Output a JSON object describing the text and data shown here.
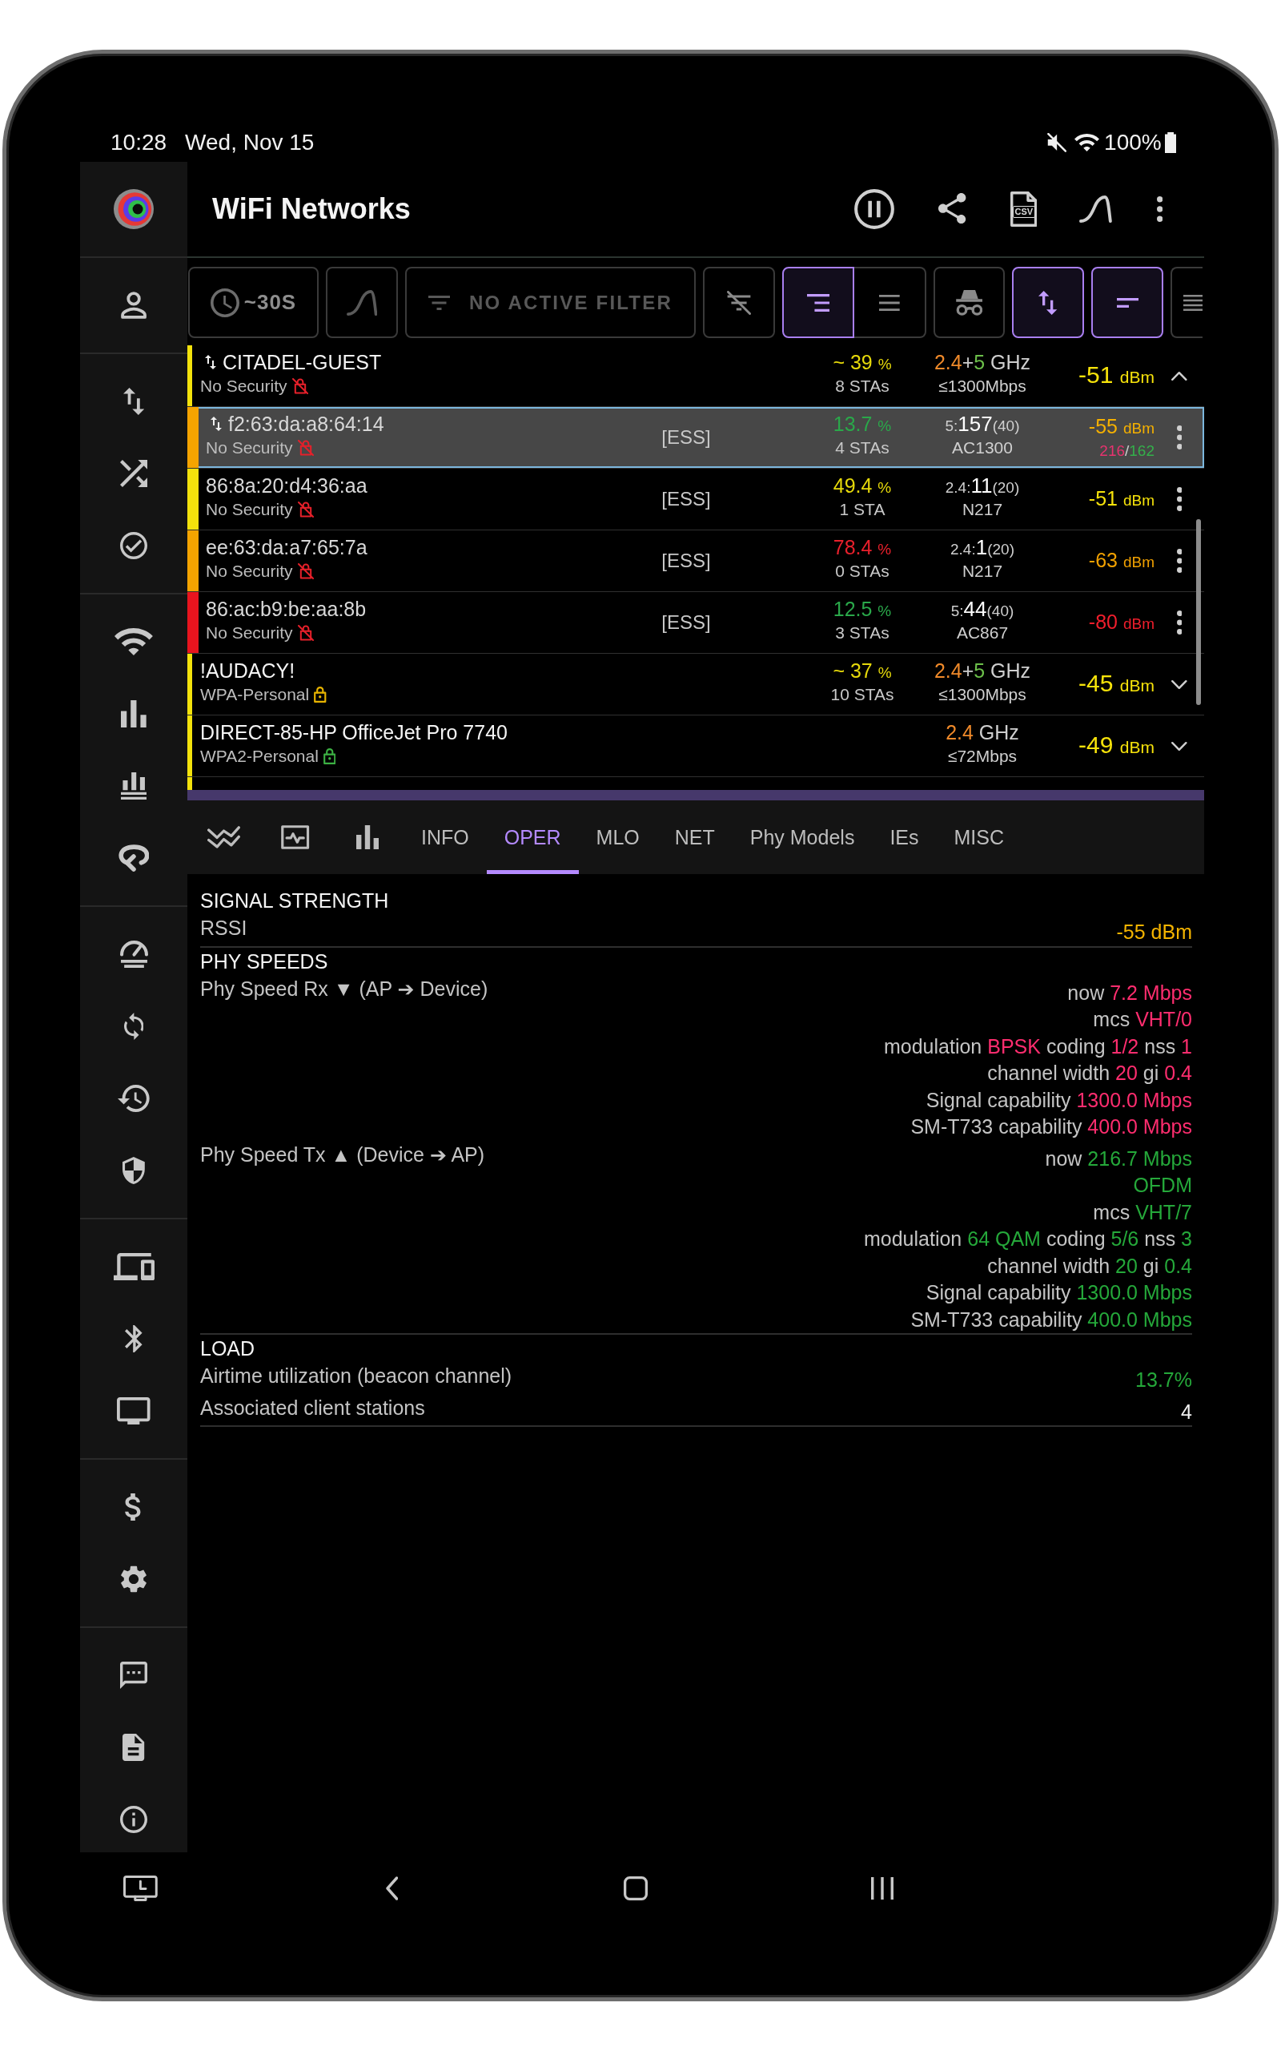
{
  "status_bar": {
    "time": "10:28",
    "date": "Wed, Nov 15",
    "battery": "100%"
  },
  "app_bar": {
    "title": "WiFi Networks",
    "export_label": "CSV"
  },
  "toolbar": [
    {
      "kind": "interval",
      "label": "~30S",
      "selected": false
    },
    {
      "kind": "graph",
      "selected": false
    },
    {
      "kind": "filter",
      "label": "NO ACTIVE FILTER",
      "selected": false
    },
    {
      "kind": "filter-off",
      "selected": false
    },
    {
      "kind": "group",
      "selected": true
    },
    {
      "kind": "ungroup",
      "selected": false
    },
    {
      "kind": "incognito",
      "selected": false
    },
    {
      "kind": "sort",
      "selected": true
    },
    {
      "kind": "compact",
      "selected": true
    },
    {
      "kind": "list",
      "selected": false
    }
  ],
  "networks": [
    {
      "kind": "network",
      "name": "CITADEL-GUEST",
      "connected": true,
      "selected": false,
      "expanded": true,
      "security": "No Security",
      "lock": {
        "kind": "unlocked",
        "color": "#e5202a"
      },
      "color": "#f3e20c",
      "load": {
        "prefix": "~",
        "value": "39",
        "unit": "%",
        "color": "#e6d90a"
      },
      "stations": "8 STAs",
      "band": {
        "low": "2.4",
        "sep": "+",
        "high": "5",
        "unit": "GHz"
      },
      "rate": "≤1300Mbps",
      "rssi": {
        "value": "-51",
        "unit": "dBm",
        "color": "#f7e30a"
      },
      "children": [
        {
          "kind": "bssid",
          "name": "f2:63:da:a8:64:14",
          "connected": true,
          "selected": true,
          "security": "No Security",
          "lock": {
            "kind": "unlocked",
            "color": "#e5202a"
          },
          "mode": "[ESS]",
          "color": "#f5a400",
          "load": {
            "value": "13.7",
            "unit": "%",
            "color": "#2aa84a"
          },
          "stations": "4 STAs",
          "channel": {
            "band": "5:",
            "number": "157",
            "width": "(40)"
          },
          "phy": "AC1300",
          "rssi": {
            "value": "-55",
            "unit": "dBm",
            "color": "#f5b000"
          },
          "rates": {
            "rx": "216",
            "sep": "/",
            "tx": "162"
          }
        },
        {
          "kind": "bssid",
          "name": "86:8a:20:d4:36:aa",
          "connected": false,
          "selected": false,
          "security": "No Security",
          "lock": {
            "kind": "unlocked",
            "color": "#e5202a"
          },
          "mode": "[ESS]",
          "color": "#f3e20c",
          "load": {
            "value": "49.4",
            "unit": "%",
            "color": "#e6d90a"
          },
          "stations": "1 STA",
          "channel": {
            "band": "2.4:",
            "number": "11",
            "width": "(20)"
          },
          "phy": "N217",
          "rssi": {
            "value": "-51",
            "unit": "dBm",
            "color": "#f7e30a"
          }
        },
        {
          "kind": "bssid",
          "name": "ee:63:da:a7:65:7a",
          "connected": false,
          "selected": false,
          "security": "No Security",
          "lock": {
            "kind": "unlocked",
            "color": "#e5202a"
          },
          "mode": "[ESS]",
          "color": "#f5a400",
          "load": {
            "value": "78.4",
            "unit": "%",
            "color": "#e8202c"
          },
          "stations": "0 STAs",
          "channel": {
            "band": "2.4:",
            "number": "1",
            "width": "(20)"
          },
          "phy": "N217",
          "rssi": {
            "value": "-63",
            "unit": "dBm",
            "color": "#f0a000"
          }
        },
        {
          "kind": "bssid",
          "name": "86:ac:b9:be:aa:8b",
          "connected": false,
          "selected": false,
          "security": "No Security",
          "lock": {
            "kind": "unlocked",
            "color": "#e5202a"
          },
          "mode": "[ESS]",
          "color": "#e8141e",
          "load": {
            "value": "12.5",
            "unit": "%",
            "color": "#2aa84a"
          },
          "stations": "3 STAs",
          "channel": {
            "band": "5:",
            "number": "44",
            "width": "(40)"
          },
          "phy": "AC867",
          "rssi": {
            "value": "-80",
            "unit": "dBm",
            "color": "#f01e2c"
          }
        }
      ]
    },
    {
      "kind": "network",
      "name": "!AUDACY!",
      "connected": false,
      "selected": false,
      "expanded": false,
      "security": "WPA-Personal",
      "lock": {
        "kind": "locked",
        "color": "#e8b400"
      },
      "color": "#f3e20c",
      "load": {
        "prefix": "~",
        "value": "37",
        "unit": "%",
        "color": "#e6d90a"
      },
      "stations": "10 STAs",
      "band": {
        "low": "2.4",
        "sep": "+",
        "high": "5",
        "unit": "GHz"
      },
      "rate": "≤1300Mbps",
      "rssi": {
        "value": "-45",
        "unit": "dBm",
        "color": "#f7e30a"
      }
    },
    {
      "kind": "network",
      "name": "DIRECT-85-HP OfficeJet Pro 7740",
      "connected": false,
      "selected": false,
      "expanded": false,
      "security": "WPA2-Personal",
      "lock": {
        "kind": "locked",
        "color": "#3cb043"
      },
      "color": "#f3e20c",
      "band": {
        "low": "2.4",
        "unit": "GHz"
      },
      "rate": "≤72Mbps",
      "rssi": {
        "value": "-49",
        "unit": "dBm",
        "color": "#f7e30a"
      }
    },
    {
      "kind": "cut",
      "color": "#f3e20c"
    }
  ],
  "detail_tabs": [
    {
      "kind": "trend",
      "selected": false
    },
    {
      "kind": "monitor",
      "selected": false
    },
    {
      "kind": "bars",
      "selected": false
    },
    {
      "kind": "text",
      "label": "INFO",
      "selected": false
    },
    {
      "kind": "text",
      "label": "OPER",
      "selected": true
    },
    {
      "kind": "text",
      "label": "MLO",
      "selected": false
    },
    {
      "kind": "text",
      "label": "NET",
      "selected": false
    },
    {
      "kind": "text",
      "label": "Phy Models",
      "selected": false
    },
    {
      "kind": "text",
      "label": "IEs",
      "selected": false
    },
    {
      "kind": "text",
      "label": "MISC",
      "selected": false
    }
  ],
  "details": [
    {
      "heading": "SIGNAL STRENGTH",
      "rows": [
        {
          "label": "RSSI",
          "color": "#f5b400",
          "lines": [
            [
              {
                "value": "-55 dBm"
              }
            ]
          ]
        }
      ]
    },
    {
      "heading": "PHY SPEEDS",
      "rows": [
        {
          "label": "Phy Speed Rx ▼ (AP ➔ Device)",
          "color": "#ff2d6f",
          "lines": [
            [
              {
                "label": "now",
                "value": "7.2 Mbps"
              }
            ],
            [
              {
                "label": "mcs",
                "value": "VHT/0"
              }
            ],
            [
              {
                "label": "modulation",
                "value": "BPSK"
              },
              {
                "label": "coding",
                "value": "1/2"
              },
              {
                "label": "nss",
                "value": "1"
              }
            ],
            [
              {
                "label": "channel width",
                "value": "20"
              },
              {
                "label": "gi",
                "value": "0.4"
              }
            ],
            [
              {
                "label": "Signal capability",
                "value": "1300.0 Mbps"
              }
            ],
            [
              {
                "label": "SM-T733 capability",
                "value": "400.0 Mbps"
              }
            ]
          ]
        },
        {
          "label": "Phy Speed Tx ▲ (Device ➔ AP)",
          "color": "#25a83a",
          "lines": [
            [
              {
                "label": "now",
                "value": "216.7 Mbps"
              }
            ],
            [
              {
                "value": "OFDM"
              }
            ],
            [
              {
                "label": "mcs",
                "value": "VHT/7"
              }
            ],
            [
              {
                "label": "modulation",
                "value": "64 QAM"
              },
              {
                "label": "coding",
                "value": "5/6"
              },
              {
                "label": "nss",
                "value": "3"
              }
            ],
            [
              {
                "label": "channel width",
                "value": "20"
              },
              {
                "label": "gi",
                "value": "0.4"
              }
            ],
            [
              {
                "label": "Signal capability",
                "value": "1300.0 Mbps"
              }
            ],
            [
              {
                "label": "SM-T733 capability",
                "value": "400.0 Mbps"
              }
            ]
          ]
        }
      ]
    },
    {
      "heading": "LOAD",
      "rows": [
        {
          "label": "Airtime utilization (beacon channel)",
          "color": "#25a83a",
          "lines": [
            [
              {
                "value": "13.7%"
              }
            ]
          ]
        },
        {
          "label": "Associated client stations",
          "color": "#f2f2f2",
          "lines": [
            [
              {
                "value": "4"
              }
            ]
          ]
        }
      ]
    }
  ]
}
